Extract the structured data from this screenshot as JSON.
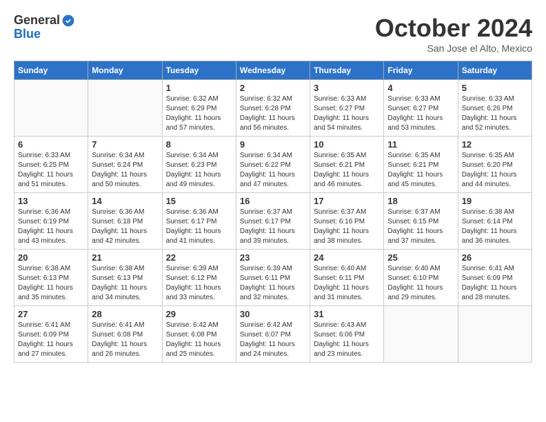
{
  "header": {
    "logo_general": "General",
    "logo_blue": "Blue",
    "month": "October 2024",
    "location": "San Jose el Alto, Mexico"
  },
  "weekdays": [
    "Sunday",
    "Monday",
    "Tuesday",
    "Wednesday",
    "Thursday",
    "Friday",
    "Saturday"
  ],
  "weeks": [
    [
      {
        "day": "",
        "info": ""
      },
      {
        "day": "",
        "info": ""
      },
      {
        "day": "1",
        "info": "Sunrise: 6:32 AM\nSunset: 6:29 PM\nDaylight: 11 hours and 57 minutes."
      },
      {
        "day": "2",
        "info": "Sunrise: 6:32 AM\nSunset: 6:28 PM\nDaylight: 11 hours and 56 minutes."
      },
      {
        "day": "3",
        "info": "Sunrise: 6:33 AM\nSunset: 6:27 PM\nDaylight: 11 hours and 54 minutes."
      },
      {
        "day": "4",
        "info": "Sunrise: 6:33 AM\nSunset: 6:27 PM\nDaylight: 11 hours and 53 minutes."
      },
      {
        "day": "5",
        "info": "Sunrise: 6:33 AM\nSunset: 6:26 PM\nDaylight: 11 hours and 52 minutes."
      }
    ],
    [
      {
        "day": "6",
        "info": "Sunrise: 6:33 AM\nSunset: 6:25 PM\nDaylight: 11 hours and 51 minutes."
      },
      {
        "day": "7",
        "info": "Sunrise: 6:34 AM\nSunset: 6:24 PM\nDaylight: 11 hours and 50 minutes."
      },
      {
        "day": "8",
        "info": "Sunrise: 6:34 AM\nSunset: 6:23 PM\nDaylight: 11 hours and 49 minutes."
      },
      {
        "day": "9",
        "info": "Sunrise: 6:34 AM\nSunset: 6:22 PM\nDaylight: 11 hours and 47 minutes."
      },
      {
        "day": "10",
        "info": "Sunrise: 6:35 AM\nSunset: 6:21 PM\nDaylight: 11 hours and 46 minutes."
      },
      {
        "day": "11",
        "info": "Sunrise: 6:35 AM\nSunset: 6:21 PM\nDaylight: 11 hours and 45 minutes."
      },
      {
        "day": "12",
        "info": "Sunrise: 6:35 AM\nSunset: 6:20 PM\nDaylight: 11 hours and 44 minutes."
      }
    ],
    [
      {
        "day": "13",
        "info": "Sunrise: 6:36 AM\nSunset: 6:19 PM\nDaylight: 11 hours and 43 minutes."
      },
      {
        "day": "14",
        "info": "Sunrise: 6:36 AM\nSunset: 6:18 PM\nDaylight: 11 hours and 42 minutes."
      },
      {
        "day": "15",
        "info": "Sunrise: 6:36 AM\nSunset: 6:17 PM\nDaylight: 11 hours and 41 minutes."
      },
      {
        "day": "16",
        "info": "Sunrise: 6:37 AM\nSunset: 6:17 PM\nDaylight: 11 hours and 39 minutes."
      },
      {
        "day": "17",
        "info": "Sunrise: 6:37 AM\nSunset: 6:16 PM\nDaylight: 11 hours and 38 minutes."
      },
      {
        "day": "18",
        "info": "Sunrise: 6:37 AM\nSunset: 6:15 PM\nDaylight: 11 hours and 37 minutes."
      },
      {
        "day": "19",
        "info": "Sunrise: 6:38 AM\nSunset: 6:14 PM\nDaylight: 11 hours and 36 minutes."
      }
    ],
    [
      {
        "day": "20",
        "info": "Sunrise: 6:38 AM\nSunset: 6:13 PM\nDaylight: 11 hours and 35 minutes."
      },
      {
        "day": "21",
        "info": "Sunrise: 6:38 AM\nSunset: 6:13 PM\nDaylight: 11 hours and 34 minutes."
      },
      {
        "day": "22",
        "info": "Sunrise: 6:39 AM\nSunset: 6:12 PM\nDaylight: 11 hours and 33 minutes."
      },
      {
        "day": "23",
        "info": "Sunrise: 6:39 AM\nSunset: 6:11 PM\nDaylight: 11 hours and 32 minutes."
      },
      {
        "day": "24",
        "info": "Sunrise: 6:40 AM\nSunset: 6:11 PM\nDaylight: 11 hours and 31 minutes."
      },
      {
        "day": "25",
        "info": "Sunrise: 6:40 AM\nSunset: 6:10 PM\nDaylight: 11 hours and 29 minutes."
      },
      {
        "day": "26",
        "info": "Sunrise: 6:41 AM\nSunset: 6:09 PM\nDaylight: 11 hours and 28 minutes."
      }
    ],
    [
      {
        "day": "27",
        "info": "Sunrise: 6:41 AM\nSunset: 6:09 PM\nDaylight: 11 hours and 27 minutes."
      },
      {
        "day": "28",
        "info": "Sunrise: 6:41 AM\nSunset: 6:08 PM\nDaylight: 11 hours and 26 minutes."
      },
      {
        "day": "29",
        "info": "Sunrise: 6:42 AM\nSunset: 6:08 PM\nDaylight: 11 hours and 25 minutes."
      },
      {
        "day": "30",
        "info": "Sunrise: 6:42 AM\nSunset: 6:07 PM\nDaylight: 11 hours and 24 minutes."
      },
      {
        "day": "31",
        "info": "Sunrise: 6:43 AM\nSunset: 6:06 PM\nDaylight: 11 hours and 23 minutes."
      },
      {
        "day": "",
        "info": ""
      },
      {
        "day": "",
        "info": ""
      }
    ]
  ]
}
